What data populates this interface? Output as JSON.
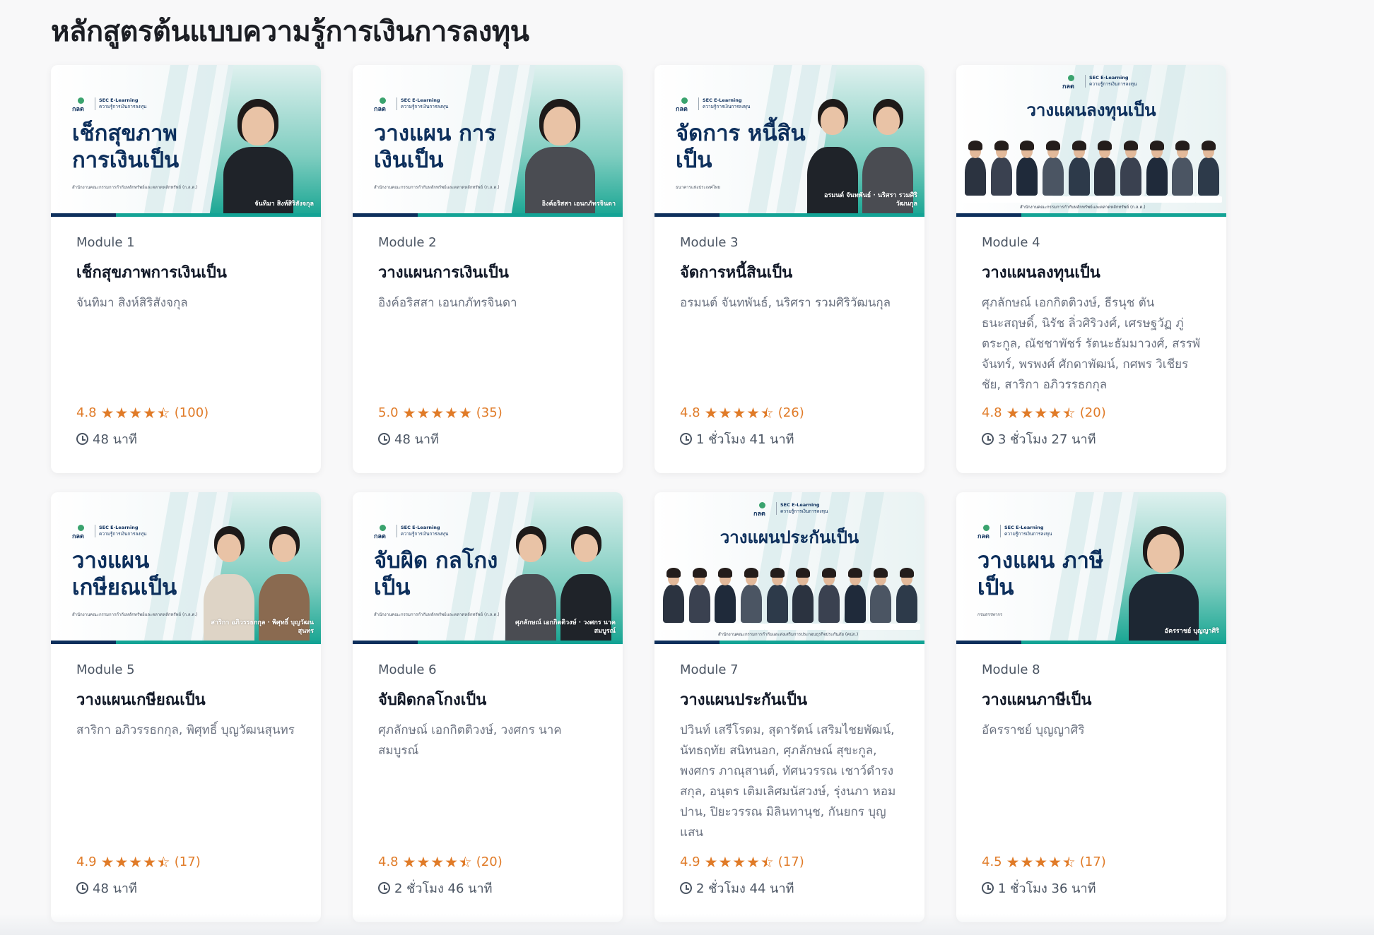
{
  "page_title": "หลักสูตรต้นแบบความรู้การเงินการลงทุน",
  "brand": {
    "logo_mark": "กลต",
    "logo_line1": "SEC E-Learning",
    "logo_line2": "ความรู้การเงินการลงทุน"
  },
  "colors": {
    "navy": "#0d2f5c",
    "teal": "#13a395",
    "rating_orange": "#e07b28"
  },
  "courses": [
    {
      "module": "Module 1",
      "banner_title": "เช็กสุขภาพ การเงินเป็น",
      "banner_credit": "สำนักงานคณะกรรมการกำกับหลักทรัพย์และตลาดหลักทรัพย์ (ก.ล.ต.)",
      "banner_names": "จันทิมา สิงห์สิริสังจกุล",
      "title": "เช็กสุขภาพการเงินเป็น",
      "authors": "จันทิมา สิงห์สิริสังจกุล",
      "rating": "4.8",
      "stars": 4.8,
      "reviews": "(100)",
      "duration": "48 นาที"
    },
    {
      "module": "Module 2",
      "banner_title": "วางแผน การเงินเป็น",
      "banner_credit": "สำนักงานคณะกรรมการกำกับหลักทรัพย์และตลาดหลักทรัพย์ (ก.ล.ต.)",
      "banner_names": "อิงค์อริสสา เอนกภัทรจินดา",
      "title": "วางแผนการเงินเป็น",
      "authors": "อิงค์อริสสา เอนกภัทรจินดา",
      "rating": "5.0",
      "stars": 5.0,
      "reviews": "(35)",
      "duration": "48 นาที"
    },
    {
      "module": "Module 3",
      "banner_title": "จัดการ หนี้สินเป็น",
      "banner_credit": "ธนาคารแห่งประเทศไทย",
      "banner_names": "อรมนต์ จันทพันธ์ · นริศรา รวมศิริวัฒนกุล",
      "title": "จัดการหนี้สินเป็น",
      "authors": "อรมนต์ จันทพันธ์, นริศรา รวมศิริวัฒนกุล",
      "rating": "4.8",
      "stars": 4.8,
      "reviews": "(26)",
      "duration": "1 ชั่วโมง 41 นาที"
    },
    {
      "module": "Module 4",
      "banner_title": "วางแผนลงทุนเป็น",
      "banner_credit": "สำนักงานคณะกรรมการกำกับหลักทรัพย์และตลาดหลักทรัพย์ (ก.ล.ต.)",
      "banner_names": "",
      "title": "วางแผนลงทุนเป็น",
      "authors": "ศุภลักษณ์ เอกกิตติวงษ์, ธีรนุช ตันธนะสฤษดิ์, นิรัช ลิ่วศิริวงศ์, เศรษฐวัฏ ภู่ตระกูล, ณัชชาพัชร์ รัตนะธัมมาวงศ์, สรรพัจันทร์, พรพงศ์ ศักดาพัฒน์, กศพร วิเชียรชัย, สาริกา อภิวรรธกกุล",
      "rating": "4.8",
      "stars": 4.8,
      "reviews": "(20)",
      "duration": "3 ชั่วโมง 27 นาที"
    },
    {
      "module": "Module 5",
      "banner_title": "วางแผน เกษียณเป็น",
      "banner_credit": "สำนักงานคณะกรรมการกำกับหลักทรัพย์และตลาดหลักทรัพย์ (ก.ล.ต.)",
      "banner_names": "สาริกา อภิวรรธกกุล · พิศุทธิ์ บุญวัฒนสุนทร",
      "title": "วางแผนเกษียณเป็น",
      "authors": "สาริกา อภิวรรธกกุล, พิศุทธิ์ บุญวัฒนสุนทร",
      "rating": "4.9",
      "stars": 4.9,
      "reviews": "(17)",
      "duration": "48 นาที"
    },
    {
      "module": "Module 6",
      "banner_title": "จับผิด กลโกงเป็น",
      "banner_credit": "สำนักงานคณะกรรมการกำกับหลักทรัพย์และตลาดหลักทรัพย์ (ก.ล.ต.)",
      "banner_names": "ศุภลักษณ์ เอกกิตติวงษ์ · วงศกร นาคสมบูรณ์",
      "title": "จับผิดกลโกงเป็น",
      "authors": "ศุภลักษณ์ เอกกิตติวงษ์, วงศกร นาคสมบูรณ์",
      "rating": "4.8",
      "stars": 4.8,
      "reviews": "(20)",
      "duration": "2 ชั่วโมง 46 นาที"
    },
    {
      "module": "Module 7",
      "banner_title": "วางแผนประกันเป็น",
      "banner_credit": "สำนักงานคณะกรรมการกำกับและส่งเสริมการประกอบธุรกิจประกันภัย (คปภ.)",
      "banner_names": "",
      "title": "วางแผนประกันเป็น",
      "authors": "ปวินท์ เสรีโรดม, สุดารัตน์ เสริมไชยพัฒน์, นัทธฤทัย สนิทนอก, ศุภลักษณ์ สุขะกูล, พงศกร ภาณุสานต์, ทัศนวรรณ เชาว์ดำรงสกุล, อนุตร เติมเลิศมนัสวงษ์, รุ่งนภา หอมปาน, ปิยะวรรณ มิลินทานุช, กันยกร บุญแสน",
      "rating": "4.9",
      "stars": 4.9,
      "reviews": "(17)",
      "duration": "2 ชั่วโมง 44 นาที"
    },
    {
      "module": "Module 8",
      "banner_title": "วางแผน ภาษีเป็น",
      "banner_credit": "กรมสรรพากร",
      "banner_names": "อัครราชย์ บุญญาศิริ",
      "title": "วางแผนภาษีเป็น",
      "authors": "อัครราชย์ บุญญาศิริ",
      "rating": "4.5",
      "stars": 4.5,
      "reviews": "(17)",
      "duration": "1 ชั่วโมง 36 นาที"
    }
  ]
}
